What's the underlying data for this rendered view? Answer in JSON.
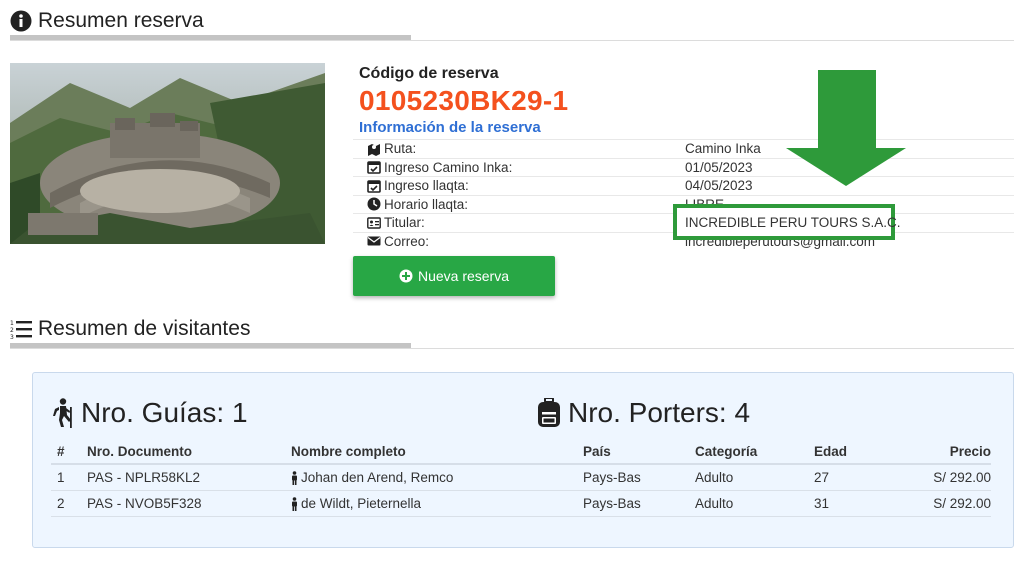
{
  "summary": {
    "title": "Resumen reserva",
    "code_label": "Código de reserva",
    "code_value": "0105230BK29-1",
    "info_title": "Información de la reserva",
    "rows": [
      {
        "label": "Ruta:",
        "value": "Camino Inka",
        "icon": "map-icon"
      },
      {
        "label": "Ingreso Camino Inka:",
        "value": "01/05/2023",
        "icon": "calendar-check-icon"
      },
      {
        "label": "Ingreso llaqta:",
        "value": "04/05/2023",
        "icon": "calendar-check-icon"
      },
      {
        "label": "Horario llaqta:",
        "value": "LIBRE",
        "icon": "clock-icon"
      },
      {
        "label": "Titular:",
        "value": "INCREDIBLE PERU TOURS S.A.C.",
        "icon": "id-card-icon"
      },
      {
        "label": "Correo:",
        "value": "incredibleperutours@gmail.com",
        "icon": "envelope-icon"
      }
    ],
    "new_button": "Nueva reserva"
  },
  "visitors": {
    "title": "Resumen de visitantes",
    "guides_title": "Nro. Guías: 1",
    "porters_title": "Nro. Porters: 4",
    "columns": [
      "#",
      "Nro. Documento",
      "Nombre completo",
      "País",
      "Categoría",
      "Edad",
      "Precio"
    ],
    "rows": [
      {
        "num": "1",
        "doc": "PAS - NPLR58KL2",
        "name": "Johan den Arend, Remco",
        "country": "Pays-Bas",
        "category": "Adulto",
        "age": "27",
        "price": "S/ 292.00"
      },
      {
        "num": "2",
        "doc": "PAS - NVOB5F328",
        "name": "de Wildt, Pieternella",
        "country": "Pays-Bas",
        "category": "Adulto",
        "age": "31",
        "price": "S/ 292.00"
      }
    ]
  },
  "colors": {
    "code": "#f4511e",
    "info_title": "#2f6fd4",
    "button": "#28a745",
    "highlight": "#2e9a3a",
    "panel": "#eef6ff"
  }
}
